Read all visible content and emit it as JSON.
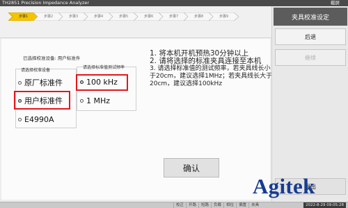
{
  "window": {
    "title": "TH2851 Precision Impedance Analyzer",
    "screenshot_label": "截屏"
  },
  "steps": [
    {
      "label": "步骤1",
      "active": true
    },
    {
      "label": "步骤2",
      "active": false
    },
    {
      "label": "步骤3",
      "active": false
    },
    {
      "label": "步骤4",
      "active": false
    },
    {
      "label": "步骤5",
      "active": false
    },
    {
      "label": "步骤6",
      "active": false
    },
    {
      "label": "步骤7",
      "active": false
    },
    {
      "label": "步骤8",
      "active": false
    },
    {
      "label": "步骤9",
      "active": false
    }
  ],
  "selected_device_text": "已选择校准设备: 用户标准件",
  "device_group": {
    "label": "请选择校准设备",
    "options": [
      {
        "label": "原厂标准件",
        "selected": false
      },
      {
        "label": "用户标准件",
        "selected": true
      },
      {
        "label": "E4990A",
        "selected": false
      }
    ]
  },
  "freq_group": {
    "label": "请选择标准值测试频率",
    "options": [
      {
        "label": "100 kHz",
        "selected": true
      },
      {
        "label": "1 MHz",
        "selected": false
      }
    ]
  },
  "instructions": {
    "line1": "1. 将本机开机预热30分钟以上",
    "line2": "2. 请将选择的标准夹具连接至本机",
    "line3": "3. 请选择标准值的测试频率，若夹具线长小于20cm，建议选择1MHz；若夹具线长大于20cm，建议选择100kHz"
  },
  "confirm_button": "确认",
  "right_panel": {
    "header": "夹具校准设定",
    "back": "后退",
    "continue": "继续",
    "exit": "退出"
  },
  "bottom_tabs": [
    "校正",
    "开路",
    "短路",
    "负载",
    "相位",
    "偏置",
    "夹具"
  ],
  "datetime": "2022-8-29 09:05:28",
  "brand": "Agitek",
  "colors": {
    "highlight_red": "#e3161b",
    "step_active": "#f5c400",
    "brand_blue": "#163c92"
  }
}
